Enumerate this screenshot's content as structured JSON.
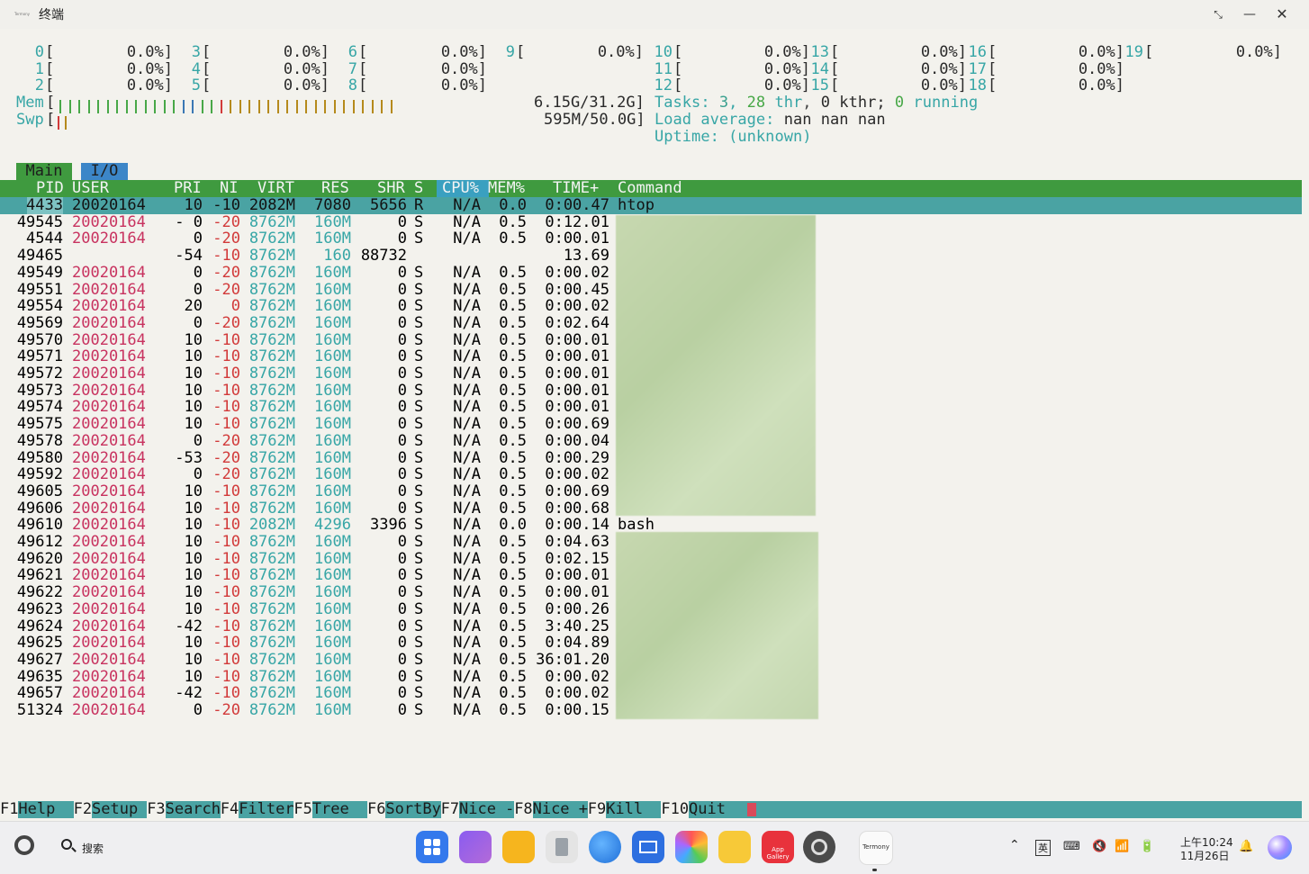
{
  "window": {
    "title": "终端",
    "app_icon_label": "Termony"
  },
  "cpus": [
    {
      "label": "0",
      "pct": "0.0%]"
    },
    {
      "label": "1",
      "pct": "0.0%]"
    },
    {
      "label": "2",
      "pct": "0.0%]"
    },
    {
      "label": "3",
      "pct": "0.0%]"
    },
    {
      "label": "4",
      "pct": "0.0%]"
    },
    {
      "label": "5",
      "pct": "0.0%]"
    },
    {
      "label": "6",
      "pct": "0.0%]"
    },
    {
      "label": "7",
      "pct": "0.0%]"
    },
    {
      "label": "8",
      "pct": "0.0%]"
    },
    {
      "label": "9",
      "pct": "0.0%]"
    },
    {
      "label": "10",
      "pct": "0.0%]"
    },
    {
      "label": "11",
      "pct": "0.0%]"
    },
    {
      "label": "12",
      "pct": "0.0%]"
    },
    {
      "label": "13",
      "pct": "0.0%]"
    },
    {
      "label": "14",
      "pct": "0.0%]"
    },
    {
      "label": "15",
      "pct": "0.0%]"
    },
    {
      "label": "16",
      "pct": "0.0%]"
    },
    {
      "label": "17",
      "pct": "0.0%]"
    },
    {
      "label": "18",
      "pct": "0.0%]"
    },
    {
      "label": "19",
      "pct": "0.0%]"
    }
  ],
  "mem": {
    "label": "Mem",
    "value": "6.15G/31.2G]"
  },
  "swp": {
    "label": "Swp",
    "value": "595M/50.0G]"
  },
  "tasks": {
    "prefix": "Tasks: ",
    "tasks": "3",
    "sep": ", ",
    "thr": "28",
    "thr_label": " thr",
    "kthr": "0",
    "kthr_label": " kthr; ",
    "running": "0",
    "running_label": " running"
  },
  "load": {
    "label": "Load average: ",
    "values": "nan nan nan"
  },
  "uptime": {
    "label": "Uptime: ",
    "value": "(unknown)"
  },
  "tabs": [
    "Main",
    "I/O"
  ],
  "columns": {
    "pid": "PID",
    "user": "USER",
    "pri": "PRI",
    "ni": "NI",
    "virt": "VIRT",
    "res": "RES",
    "shr": "SHR",
    "s": "S",
    "cpu": "CPU%",
    "mem": "MEM%",
    "time": "TIME+",
    "command": "Command"
  },
  "processes": [
    {
      "pid": "4433",
      "user": "20020164",
      "pri": "10",
      "ni": "-10",
      "virt": "2082M",
      "res": "7080",
      "shr": "5656",
      "s": "R",
      "cpu": "N/A",
      "mem": "0.0",
      "time": "0:00.47",
      "cmd": "htop"
    },
    {
      "pid": "49545",
      "user": "20020164",
      "pri": "- 0",
      "ni": "-20",
      "virt": "8762M",
      "res": "160M",
      "shr": "0",
      "s": "S",
      "cpu": "N/A",
      "mem": "0.5",
      "time": "0:12.01",
      "cmd": ""
    },
    {
      "pid": "4544",
      "user": "20020164",
      "pri": "0",
      "ni": "-20",
      "virt": "8762M",
      "res": "160M",
      "shr": "0",
      "s": "S",
      "cpu": "N/A",
      "mem": "0.5",
      "time": "0:00.01",
      "cmd": ""
    },
    {
      "pid": "49465",
      "user": "",
      "pri": "-54",
      "ni": "-10",
      "virt": "8762M",
      "res": "160",
      "shr": "88732",
      "s": "",
      "cpu": "",
      "mem": "",
      "time": "13.69",
      "cmd": ""
    },
    {
      "pid": "49549",
      "user": "20020164",
      "pri": "0",
      "ni": "-20",
      "virt": "8762M",
      "res": "160M",
      "shr": "0",
      "s": "S",
      "cpu": "N/A",
      "mem": "0.5",
      "time": "0:00.02",
      "cmd": ""
    },
    {
      "pid": "49551",
      "user": "20020164",
      "pri": "0",
      "ni": "-20",
      "virt": "8762M",
      "res": "160M",
      "shr": "0",
      "s": "S",
      "cpu": "N/A",
      "mem": "0.5",
      "time": "0:00.45",
      "cmd": ""
    },
    {
      "pid": "49554",
      "user": "20020164",
      "pri": "20",
      "ni": "0",
      "virt": "8762M",
      "res": "160M",
      "shr": "0",
      "s": "S",
      "cpu": "N/A",
      "mem": "0.5",
      "time": "0:00.02",
      "cmd": ""
    },
    {
      "pid": "49569",
      "user": "20020164",
      "pri": "0",
      "ni": "-20",
      "virt": "8762M",
      "res": "160M",
      "shr": "0",
      "s": "S",
      "cpu": "N/A",
      "mem": "0.5",
      "time": "0:02.64",
      "cmd": ""
    },
    {
      "pid": "49570",
      "user": "20020164",
      "pri": "10",
      "ni": "-10",
      "virt": "8762M",
      "res": "160M",
      "shr": "0",
      "s": "S",
      "cpu": "N/A",
      "mem": "0.5",
      "time": "0:00.01",
      "cmd": ""
    },
    {
      "pid": "49571",
      "user": "20020164",
      "pri": "10",
      "ni": "-10",
      "virt": "8762M",
      "res": "160M",
      "shr": "0",
      "s": "S",
      "cpu": "N/A",
      "mem": "0.5",
      "time": "0:00.01",
      "cmd": ""
    },
    {
      "pid": "49572",
      "user": "20020164",
      "pri": "10",
      "ni": "-10",
      "virt": "8762M",
      "res": "160M",
      "shr": "0",
      "s": "S",
      "cpu": "N/A",
      "mem": "0.5",
      "time": "0:00.01",
      "cmd": ""
    },
    {
      "pid": "49573",
      "user": "20020164",
      "pri": "10",
      "ni": "-10",
      "virt": "8762M",
      "res": "160M",
      "shr": "0",
      "s": "S",
      "cpu": "N/A",
      "mem": "0.5",
      "time": "0:00.01",
      "cmd": ""
    },
    {
      "pid": "49574",
      "user": "20020164",
      "pri": "10",
      "ni": "-10",
      "virt": "8762M",
      "res": "160M",
      "shr": "0",
      "s": "S",
      "cpu": "N/A",
      "mem": "0.5",
      "time": "0:00.01",
      "cmd": ""
    },
    {
      "pid": "49575",
      "user": "20020164",
      "pri": "10",
      "ni": "-10",
      "virt": "8762M",
      "res": "160M",
      "shr": "0",
      "s": "S",
      "cpu": "N/A",
      "mem": "0.5",
      "time": "0:00.69",
      "cmd": ""
    },
    {
      "pid": "49578",
      "user": "20020164",
      "pri": "0",
      "ni": "-20",
      "virt": "8762M",
      "res": "160M",
      "shr": "0",
      "s": "S",
      "cpu": "N/A",
      "mem": "0.5",
      "time": "0:00.04",
      "cmd": ""
    },
    {
      "pid": "49580",
      "user": "20020164",
      "pri": "-53",
      "ni": "-20",
      "virt": "8762M",
      "res": "160M",
      "shr": "0",
      "s": "S",
      "cpu": "N/A",
      "mem": "0.5",
      "time": "0:00.29",
      "cmd": ""
    },
    {
      "pid": "49592",
      "user": "20020164",
      "pri": "0",
      "ni": "-20",
      "virt": "8762M",
      "res": "160M",
      "shr": "0",
      "s": "S",
      "cpu": "N/A",
      "mem": "0.5",
      "time": "0:00.02",
      "cmd": ""
    },
    {
      "pid": "49605",
      "user": "20020164",
      "pri": "10",
      "ni": "-10",
      "virt": "8762M",
      "res": "160M",
      "shr": "0",
      "s": "S",
      "cpu": "N/A",
      "mem": "0.5",
      "time": "0:00.69",
      "cmd": ""
    },
    {
      "pid": "49606",
      "user": "20020164",
      "pri": "10",
      "ni": "-10",
      "virt": "8762M",
      "res": "160M",
      "shr": "0",
      "s": "S",
      "cpu": "N/A",
      "mem": "0.5",
      "time": "0:00.68",
      "cmd": ""
    },
    {
      "pid": "49610",
      "user": "20020164",
      "pri": "10",
      "ni": "-10",
      "virt": "2082M",
      "res": "4296",
      "shr": "3396",
      "s": "S",
      "cpu": "N/A",
      "mem": "0.0",
      "time": "0:00.14",
      "cmd": "bash"
    },
    {
      "pid": "49612",
      "user": "20020164",
      "pri": "10",
      "ni": "-10",
      "virt": "8762M",
      "res": "160M",
      "shr": "0",
      "s": "S",
      "cpu": "N/A",
      "mem": "0.5",
      "time": "0:04.63",
      "cmd": ""
    },
    {
      "pid": "49620",
      "user": "20020164",
      "pri": "10",
      "ni": "-10",
      "virt": "8762M",
      "res": "160M",
      "shr": "0",
      "s": "S",
      "cpu": "N/A",
      "mem": "0.5",
      "time": "0:02.15",
      "cmd": ""
    },
    {
      "pid": "49621",
      "user": "20020164",
      "pri": "10",
      "ni": "-10",
      "virt": "8762M",
      "res": "160M",
      "shr": "0",
      "s": "S",
      "cpu": "N/A",
      "mem": "0.5",
      "time": "0:00.01",
      "cmd": ""
    },
    {
      "pid": "49622",
      "user": "20020164",
      "pri": "10",
      "ni": "-10",
      "virt": "8762M",
      "res": "160M",
      "shr": "0",
      "s": "S",
      "cpu": "N/A",
      "mem": "0.5",
      "time": "0:00.01",
      "cmd": ""
    },
    {
      "pid": "49623",
      "user": "20020164",
      "pri": "10",
      "ni": "-10",
      "virt": "8762M",
      "res": "160M",
      "shr": "0",
      "s": "S",
      "cpu": "N/A",
      "mem": "0.5",
      "time": "0:00.26",
      "cmd": ""
    },
    {
      "pid": "49624",
      "user": "20020164",
      "pri": "-42",
      "ni": "-10",
      "virt": "8762M",
      "res": "160M",
      "shr": "0",
      "s": "S",
      "cpu": "N/A",
      "mem": "0.5",
      "time": "3:40.25",
      "cmd": ""
    },
    {
      "pid": "49625",
      "user": "20020164",
      "pri": "10",
      "ni": "-10",
      "virt": "8762M",
      "res": "160M",
      "shr": "0",
      "s": "S",
      "cpu": "N/A",
      "mem": "0.5",
      "time": "0:04.89",
      "cmd": ""
    },
    {
      "pid": "49627",
      "user": "20020164",
      "pri": "10",
      "ni": "-10",
      "virt": "8762M",
      "res": "160M",
      "shr": "0",
      "s": "S",
      "cpu": "N/A",
      "mem": "0.5",
      "time": "36:01.20",
      "cmd": ""
    },
    {
      "pid": "49635",
      "user": "20020164",
      "pri": "10",
      "ni": "-10",
      "virt": "8762M",
      "res": "160M",
      "shr": "0",
      "s": "S",
      "cpu": "N/A",
      "mem": "0.5",
      "time": "0:00.02",
      "cmd": ""
    },
    {
      "pid": "49657",
      "user": "20020164",
      "pri": "-42",
      "ni": "-10",
      "virt": "8762M",
      "res": "160M",
      "shr": "0",
      "s": "S",
      "cpu": "N/A",
      "mem": "0.5",
      "time": "0:00.02",
      "cmd": ""
    },
    {
      "pid": "51324",
      "user": "20020164",
      "pri": "0",
      "ni": "-20",
      "virt": "8762M",
      "res": "160M",
      "shr": "0",
      "s": "S",
      "cpu": "N/A",
      "mem": "0.5",
      "time": "0:00.15",
      "cmd": ""
    }
  ],
  "fkeys": [
    {
      "key": "F1",
      "label": "Help  "
    },
    {
      "key": "F2",
      "label": "Setup "
    },
    {
      "key": "F3",
      "label": "Search"
    },
    {
      "key": "F4",
      "label": "Filter"
    },
    {
      "key": "F5",
      "label": "Tree  "
    },
    {
      "key": "F6",
      "label": "SortBy"
    },
    {
      "key": "F7",
      "label": "Nice -"
    },
    {
      "key": "F8",
      "label": "Nice +"
    },
    {
      "key": "F9",
      "label": "Kill  "
    },
    {
      "key": "F10",
      "label": "Quit  "
    }
  ],
  "taskbar": {
    "search_label": "搜索",
    "app_gallery_label": "App Gallery",
    "termony_label": "Termony",
    "ime_label": "英",
    "time": "上午10:24",
    "date": "11月26日"
  },
  "colors": {
    "header_green": "#3f9a3f",
    "selection_teal": "#4aa3a3",
    "io_tab_blue": "#3c86c8"
  }
}
